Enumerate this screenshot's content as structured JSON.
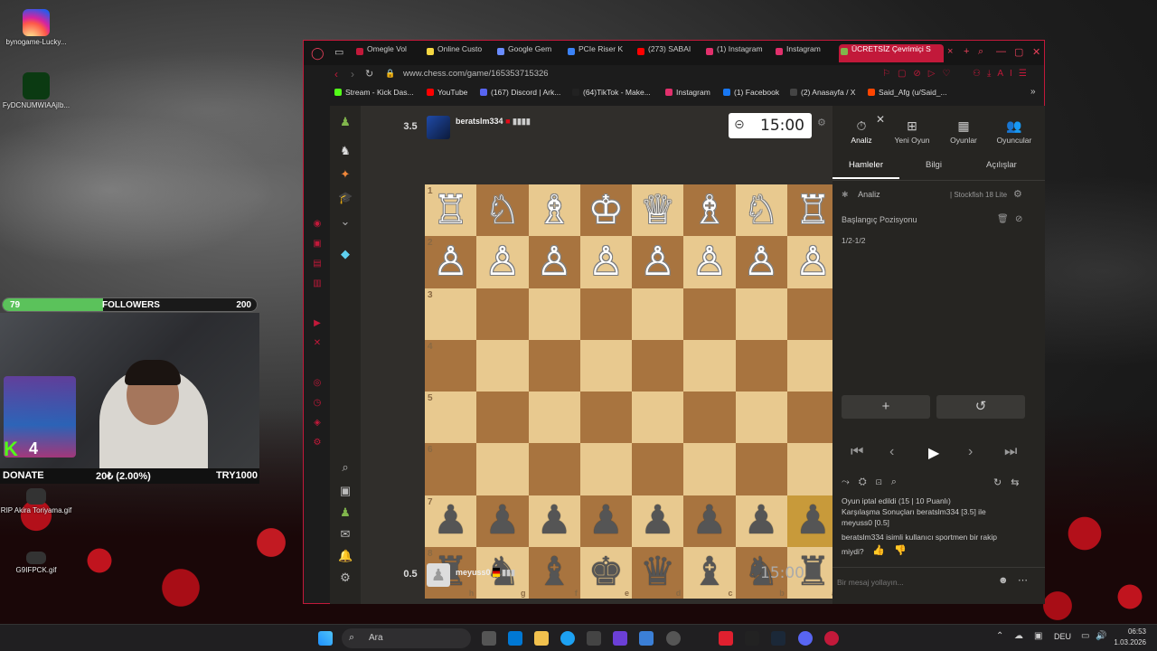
{
  "desktop": {
    "icons": [
      {
        "label": "bynogame-Lucky...",
        "icon": "instagram-icon"
      },
      {
        "label": "FyDCNUMWIAAjIb...",
        "icon": "image-icon"
      },
      {
        "label": "RIP Akira Toriyama.gif",
        "icon": "gif-icon"
      },
      {
        "label": "G9IFPCK.gif",
        "icon": "gif-icon"
      }
    ]
  },
  "overlay": {
    "followers_current": "79",
    "followers_label": "FOLLOWERS",
    "followers_goal": "200",
    "followers_progress": 0.395,
    "kick_count": "4",
    "donate_label": "DONATE",
    "donate_amount": "20₺ (2.00%)",
    "donate_goal": "TRY1000"
  },
  "browser": {
    "tabs": [
      {
        "label": "Omegle Vol",
        "color": "#c2193a"
      },
      {
        "label": "Online Custo",
        "color": "#f5d742"
      },
      {
        "label": "Google Gem",
        "color": "#6a8cff"
      },
      {
        "label": "PCIe Riser K",
        "color": "#3b82f6"
      },
      {
        "label": "(273) SABAI",
        "color": "#ff0000"
      },
      {
        "label": "(1) Instagram",
        "color": "#e1306c"
      },
      {
        "label": "Instagram",
        "color": "#e1306c"
      },
      {
        "label": "ÜCRETSİZ Çevrimiçi S",
        "color": "#81b64c"
      }
    ],
    "url": "www.chess.com/game/165353715326",
    "bookmarks": [
      {
        "label": "Stream - Kick Das...",
        "color": "#53fc18"
      },
      {
        "label": "YouTube",
        "color": "#ff0000"
      },
      {
        "label": "(167) Discord | Ark...",
        "color": "#5865f2"
      },
      {
        "label": "(64)TikTok - Make...",
        "color": "#222222"
      },
      {
        "label": "Instagram",
        "color": "#e1306c"
      },
      {
        "label": "(1) Facebook",
        "color": "#1877f2"
      },
      {
        "label": "(2) Anasayfa / X",
        "color": "#000000"
      },
      {
        "label": "Said_Afg (u/Said_...",
        "color": "#ff4500"
      }
    ]
  },
  "game": {
    "top_player": {
      "score": "3.5",
      "name": "beratslm334",
      "clock": "15:00"
    },
    "bottom_player": {
      "score": "0.5",
      "name": "meyuss0",
      "clock": "15:00"
    },
    "board": [
      [
        "♖",
        "♘",
        "♗",
        "♔",
        "♕",
        "♗",
        "♘",
        "♖"
      ],
      [
        "♙",
        "♙",
        "♙",
        "♙",
        "♙",
        "♙",
        "♙",
        "♙"
      ],
      [
        "",
        "",
        "",
        "",
        "",
        "",
        "",
        ""
      ],
      [
        "",
        "",
        "",
        "",
        "",
        "",
        "",
        ""
      ],
      [
        "",
        "",
        "",
        "",
        "",
        "",
        "",
        ""
      ],
      [
        "",
        "",
        "",
        "",
        "",
        "",
        "",
        ""
      ],
      [
        "♟",
        "♟",
        "♟",
        "♟",
        "♟",
        "♟",
        "♟",
        "♟"
      ],
      [
        "♜",
        "♞",
        "♝",
        "♚",
        "♛",
        "♝",
        "♞",
        "♜"
      ]
    ],
    "board_colors": [
      "w",
      "w",
      "",
      "",
      "",
      "",
      "b",
      "b"
    ],
    "ranks": [
      "1",
      "2",
      "3",
      "4",
      "5",
      "6",
      "7",
      "8"
    ],
    "files": [
      "h",
      "g",
      "f",
      "e",
      "d",
      "c",
      "b",
      "a"
    ]
  },
  "panel": {
    "top_tabs": [
      {
        "label": "Analiz",
        "icon": "stopwatch-icon",
        "glyph": "⏱"
      },
      {
        "label": "Yeni Oyun",
        "icon": "plus-board-icon",
        "glyph": "⊞"
      },
      {
        "label": "Oyunlar",
        "icon": "board-icon",
        "glyph": "▦"
      },
      {
        "label": "Oyuncular",
        "icon": "players-icon",
        "glyph": "👥"
      }
    ],
    "sub_tabs": [
      "Hamleler",
      "Bilgi",
      "Açılışlar"
    ],
    "analysis_label": "Analiz",
    "engine": "Stockfish 18 Lite",
    "start_position": "Başlangıç Pozisyonu",
    "result": "1/2-1/2",
    "chat": [
      "Oyun iptal edildi (15 | 10 Puanlı)",
      "Karşılaşma Sonuçları beratslm334 [3.5] ile",
      "meyuss0 [0.5]",
      "beratslm334 isimli kullanıcı sportmen bir rakip",
      "miydi?"
    ],
    "chat_placeholder": "Bir mesaj yollayın..."
  },
  "taskbar": {
    "search_label": "Ara",
    "lang": "DEU",
    "time": "06:53",
    "date": "1.03.2026"
  }
}
